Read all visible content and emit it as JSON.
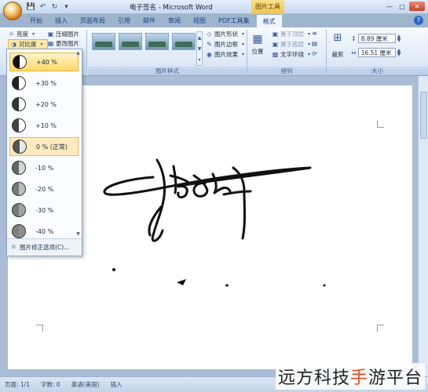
{
  "title_bar": {
    "document_title": "电子签名 - Microsoft Word",
    "context_tools_title": "图片工具",
    "qat_icons": [
      "save-icon",
      "undo-icon",
      "redo-icon",
      "qat-menu-icon"
    ],
    "window_controls": [
      "minimize",
      "maximize",
      "close"
    ]
  },
  "tabs": [
    "开始",
    "插入",
    "页面布局",
    "引用",
    "邮件",
    "审阅",
    "视图",
    "PDF工具集",
    "格式"
  ],
  "ribbon": {
    "adjust": {
      "brightness": "亮度",
      "contrast": "对比度",
      "compress": "压缩图片",
      "change": "更改图片"
    },
    "picture_styles": {
      "label": "图片样式",
      "shape": "图片形状",
      "border": "图片边框",
      "effects": "图片效果"
    },
    "arrange": {
      "label": "排列",
      "position": "位置",
      "bring_front": "置于顶层",
      "send_back": "置于底层",
      "text_wrap": "文字环绕"
    },
    "size": {
      "label": "大小",
      "crop": "裁剪",
      "height": "8.89 厘米",
      "width": "16.51 厘米"
    }
  },
  "contrast_menu": {
    "items": [
      "+40 %",
      "+30 %",
      "+20 %",
      "+10 %",
      "0 % (正常)",
      "-10 %",
      "-20 %",
      "-30 %",
      "-40 %"
    ],
    "footer": "图片修正选项(C)...",
    "hover_index": 0,
    "selected_index": 4
  },
  "status_bar": {
    "page": "页面: 1/1",
    "words": "字数: 0",
    "language": "英语(美国)",
    "mode": "插入"
  },
  "watermark": {
    "prefix": "远方科技",
    "highlight": "手",
    "suffix": "游平台"
  }
}
